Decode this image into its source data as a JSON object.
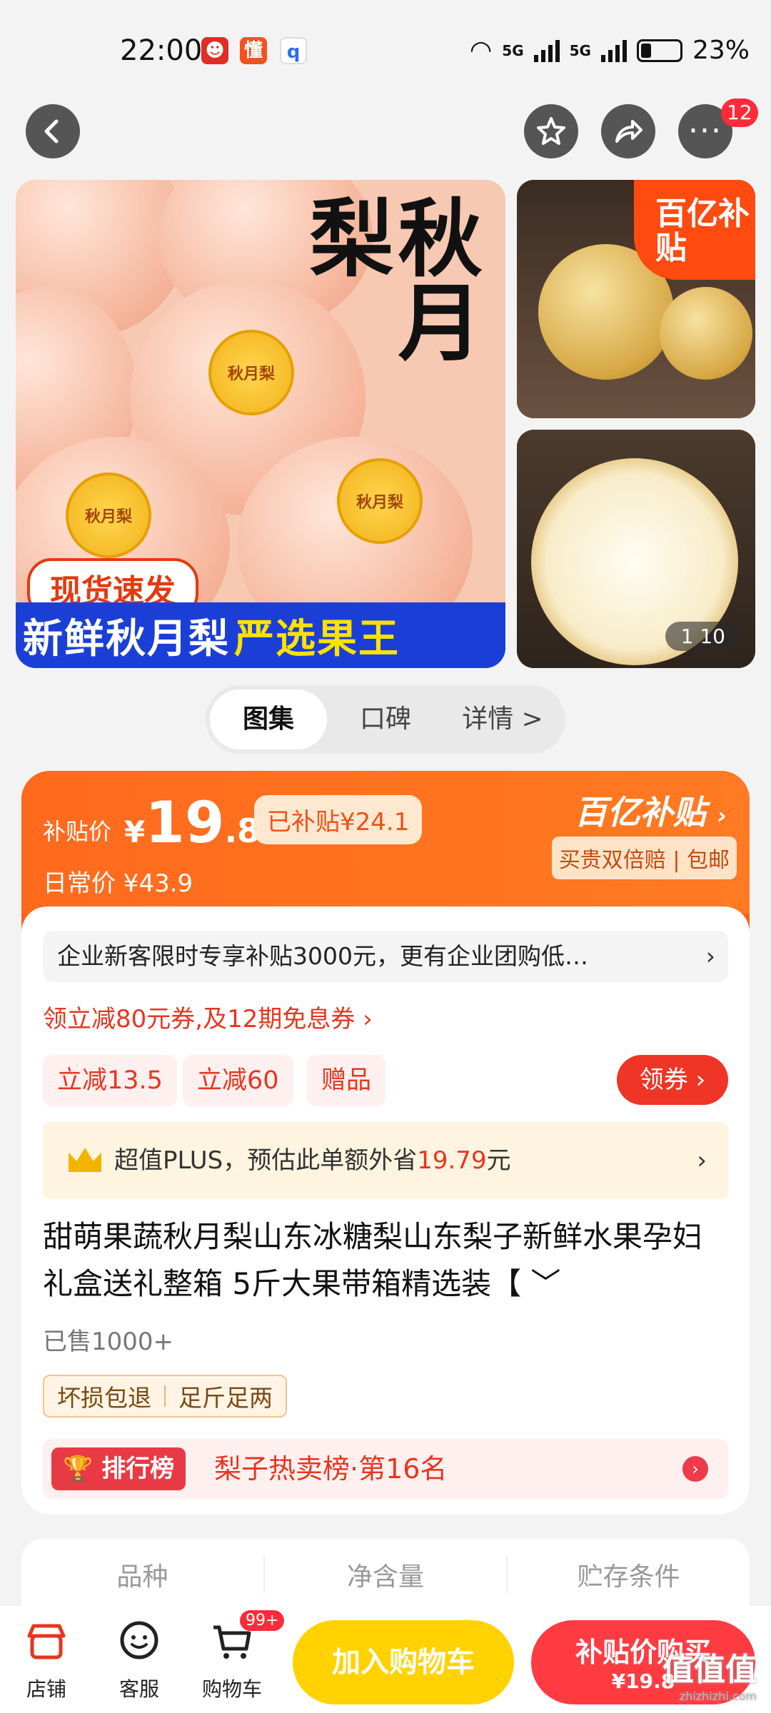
{
  "status": {
    "time": "22:00",
    "network1": "5G",
    "network2": "5G",
    "battery": "23%"
  },
  "nav": {
    "notification_count": "12"
  },
  "gallery": {
    "hero_title": "秋月梨",
    "pear_label": "秋月梨",
    "fast_tag": "现货速发",
    "band_white": "新鲜秋月梨",
    "band_yellow": "严选果王",
    "subsidy_tag": "百亿补贴",
    "page_current": "1",
    "page_total": "10"
  },
  "tabs": [
    "图集",
    "口碑",
    "详情 >"
  ],
  "price": {
    "label": "补贴价",
    "currency": "¥",
    "integer": "19",
    "decimal": ".8",
    "subsidized": "已补贴¥24.1",
    "regular": "日常价 ¥43.9",
    "program": "百亿补贴",
    "program_sub": "买贵双倍赔 | 包邮"
  },
  "promo": {
    "text": "企业新客限时专享补贴3000元，更有企业团购低…",
    "arrow": "›"
  },
  "coupon_line": "领立减80元券,及12期免息券 ›",
  "chips": [
    "立减13.5",
    "立减60",
    "赠品"
  ],
  "get_coupon": "领券 ›",
  "plus": {
    "text": "超值PLUS，预估此单额外省",
    "amount": "19.79",
    "unit": "元",
    "arrow": "›"
  },
  "product": {
    "title": "甜萌果蔬秋月梨山东冰糖梨山东梨子新鲜水果孕妇礼盒送礼整箱 5斤大果带箱精选装【 ﹀",
    "sold": "已售1000+"
  },
  "guarantees": [
    "坏损包退",
    "足斤足两"
  ],
  "rank": {
    "badge": "排行榜",
    "text": "梨子热卖榜·第16名",
    "arrow": "›"
  },
  "specs": [
    "品种",
    "净含量",
    "贮存条件"
  ],
  "bottom": {
    "shop": "店铺",
    "service": "客服",
    "cart": "购物车",
    "cart_badge": "99+",
    "add_cart": "加入购物车",
    "buy_line1": "补贴价购买",
    "buy_line2": "¥19.8",
    "watermark": "值值值",
    "watermark_url": "zhizhizhi.com"
  },
  "colors": {
    "accent": "#ff5f19",
    "red": "#e8351f",
    "yellow_btn": "#ffd200",
    "buy_btn": "#ff3b42"
  }
}
